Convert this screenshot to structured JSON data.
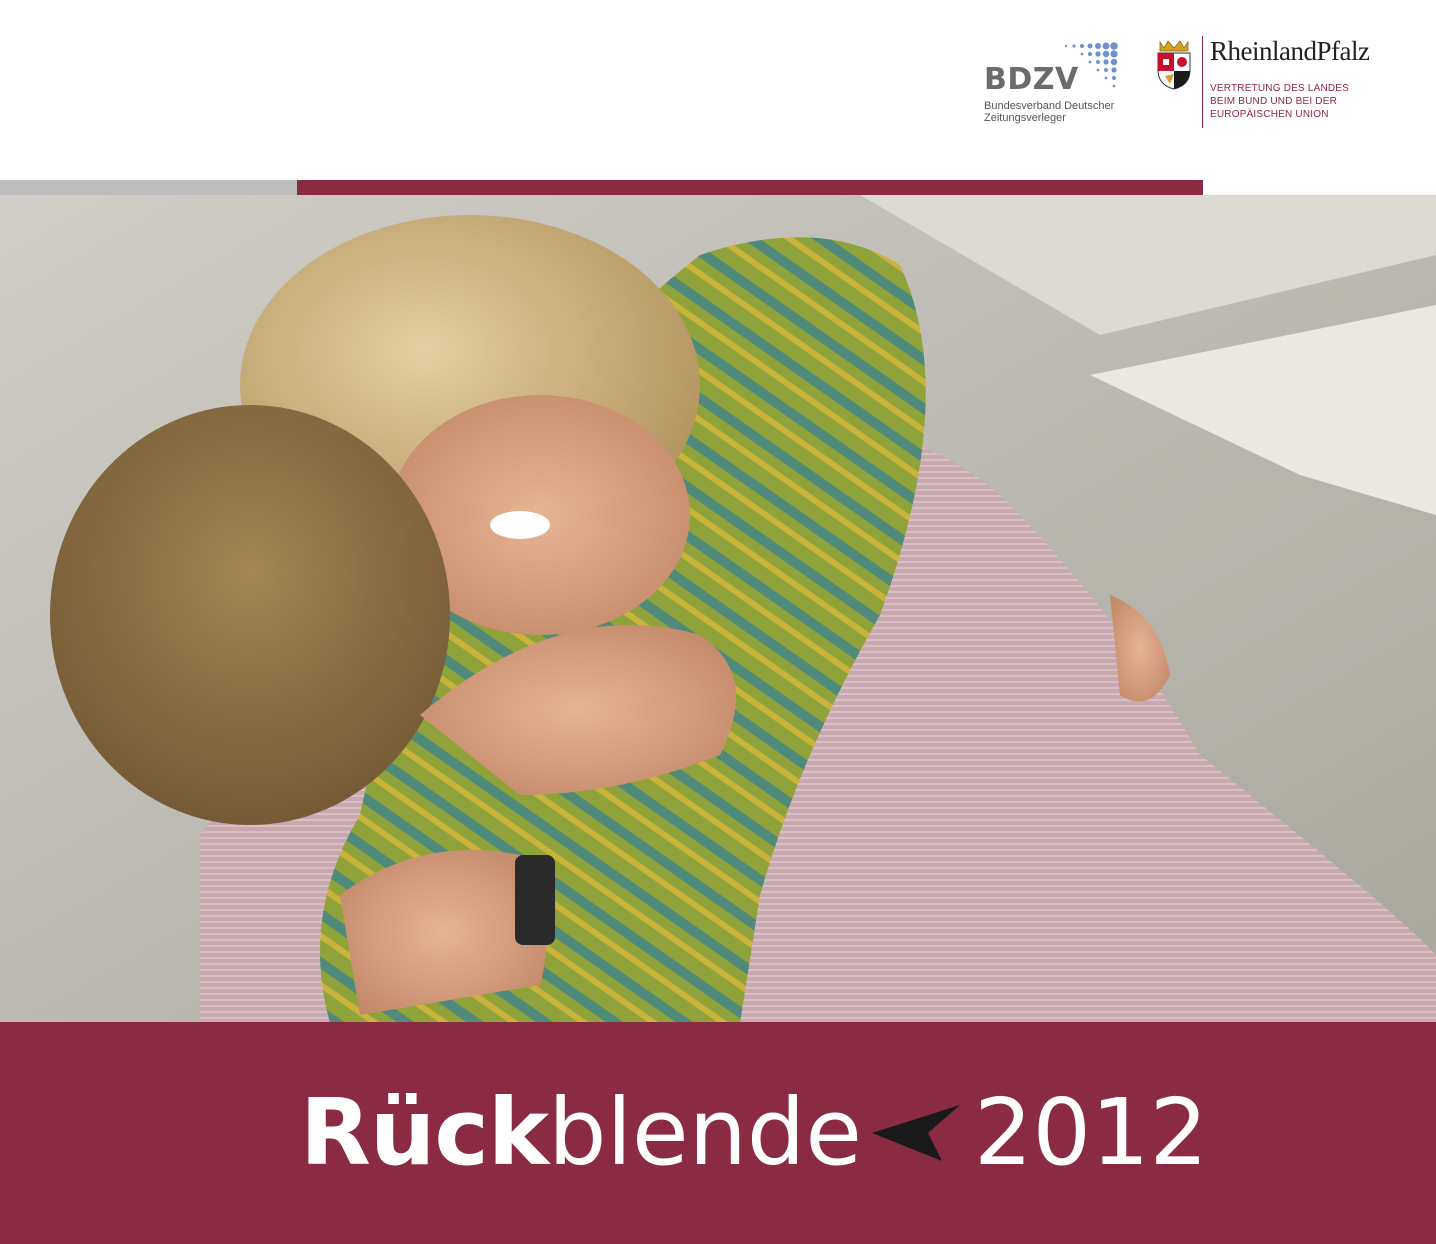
{
  "logos": {
    "bdzv": {
      "name": "BDZV",
      "subtitle_line1": "Bundesverband Deutscher",
      "subtitle_line2": "Zeitungsverleger",
      "color": "#6b6b6b",
      "dot_color": "#6f8fcf"
    },
    "rlp": {
      "name": "RheinlandPfalz",
      "subtitle_line1": "VERTRETUNG DES LANDES",
      "subtitle_line2": "BEIM BUND UND BEI DER",
      "subtitle_line3": "EUROPÄISCHEN UNION",
      "color": "#8b2b43"
    }
  },
  "colors": {
    "brand": "#8b2b43",
    "grey_bar": "#bdbdbd",
    "title_text": "#ffffff",
    "arrow": "#1a1a1a"
  },
  "photo": {
    "icon": "photo-two-women-embracing"
  },
  "title": {
    "bold_part": "Rück",
    "light_part": "blende",
    "arrow_icon": "left-arrowhead-icon",
    "year": "2012"
  }
}
